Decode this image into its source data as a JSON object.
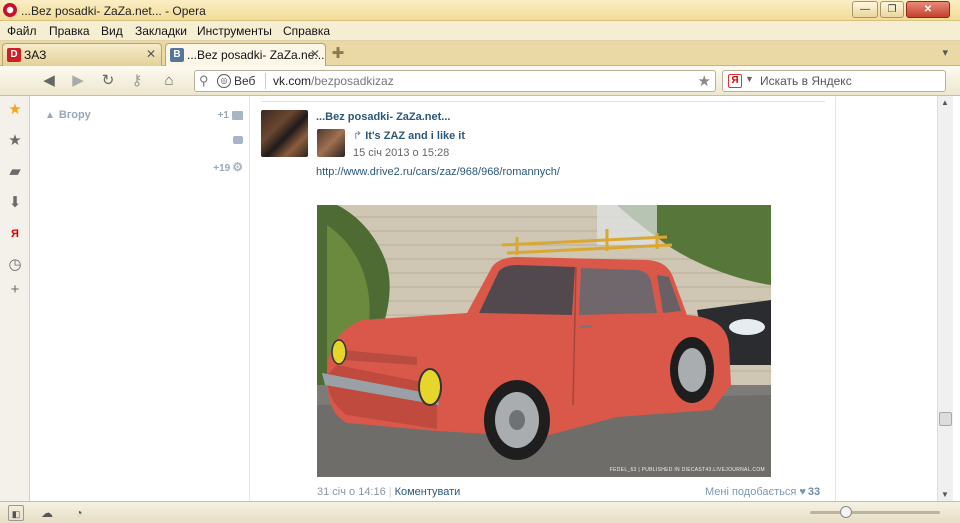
{
  "window": {
    "title": "...Bez posadki- ZaZa.net... - Opera",
    "buttons": {
      "minimize": "—",
      "maximize": "❐",
      "close": "✕"
    }
  },
  "menu": [
    "Файл",
    "Правка",
    "Вид",
    "Закладки",
    "Инструменты",
    "Справка"
  ],
  "tabs": [
    {
      "label": "ЗАЗ",
      "favicon": "D",
      "favicon_color": "#cc2027",
      "close": "✕",
      "active": false
    },
    {
      "label": "...Bez posadki- ZaZa.ne...",
      "favicon": "B",
      "favicon_color": "#55769c",
      "close": "✕",
      "active": true
    }
  ],
  "toolbar": {
    "address": {
      "scope_label": "Веб",
      "host": "vk.com",
      "path": "/bezposadkizaz"
    },
    "search_placeholder": "Искать в Яндекс",
    "search_engine_glyph": "Я"
  },
  "opera_sidebar": {
    "items": [
      "star-filled",
      "star",
      "notes",
      "downloads",
      "yandex",
      "history",
      "add"
    ],
    "yandex_glyph": "Я"
  },
  "left_column": {
    "up_label": "Вгору",
    "stats": [
      {
        "value": "+1",
        "icon": "envelope-icon"
      },
      {
        "value": "",
        "icon": "comment-icon"
      },
      {
        "value": "+19",
        "icon": "gear-icon"
      }
    ]
  },
  "post": {
    "author": "...Bez posadki- ZaZa.net...",
    "repost_title": "It's ZAZ and i like it",
    "repost_date": "15 січ 2013 о 15:28",
    "link": "http://www.drive2.ru/cars/zaz/968/968/romannych/",
    "photo_caption": "FEDEL_63 | PUBLISHED IN DIECAST43.LIVEJOURNAL.COM",
    "date": "31 січ о 14:16",
    "comment_label": "Коментувати",
    "like_label": "Мені подобається",
    "like_count": "33"
  },
  "colors": {
    "link": "#2b587a",
    "opera_red": "#c8102e",
    "title_bar": "#f1dc97"
  }
}
